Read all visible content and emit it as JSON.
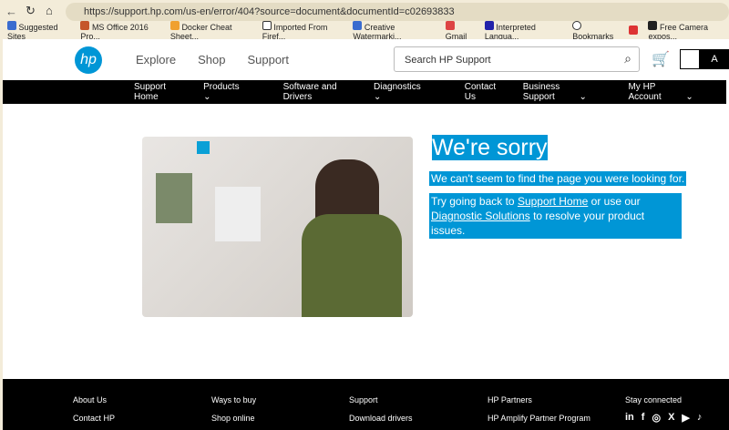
{
  "browser": {
    "url": "https://support.hp.com/us-en/error/404?source=document&documentId=c02693833",
    "bookmarks": [
      "Suggested Sites",
      "MS Office 2016 Pro...",
      "Docker Cheat Sheet...",
      "Imported From Firef...",
      "Creative Watermarki...",
      "Gmail",
      "Interpreted Langua...",
      "Bookmarks",
      "Free Camera expos..."
    ]
  },
  "header": {
    "logo": "hp",
    "links": [
      "Explore",
      "Shop",
      "Support"
    ],
    "search_placeholder": "Search HP Support",
    "avatar": "A"
  },
  "nav": [
    "Support Home",
    "Products",
    "Software and Drivers",
    "Diagnostics",
    "Contact Us",
    "Business Support",
    "My HP Account"
  ],
  "error": {
    "title": "We're sorry",
    "line1": "We can't seem to find the page you were looking for.",
    "line2a": "Try going back to ",
    "link1": "Support Home",
    "line2b": " or use our",
    "link2": "Diagnostic Solutions",
    "line2c": " to resolve your product issues."
  },
  "footer": {
    "cols": [
      {
        "head": "About Us",
        "item": "Contact HP"
      },
      {
        "head": "Ways to buy",
        "item": "Shop online"
      },
      {
        "head": "Support",
        "item": "Download drivers"
      },
      {
        "head": "HP Partners",
        "item": "HP Amplify Partner Program"
      },
      {
        "head": "Stay connected",
        "item": ""
      }
    ],
    "social": [
      "in",
      "f",
      "◎",
      "X",
      "▶",
      "♪"
    ]
  }
}
